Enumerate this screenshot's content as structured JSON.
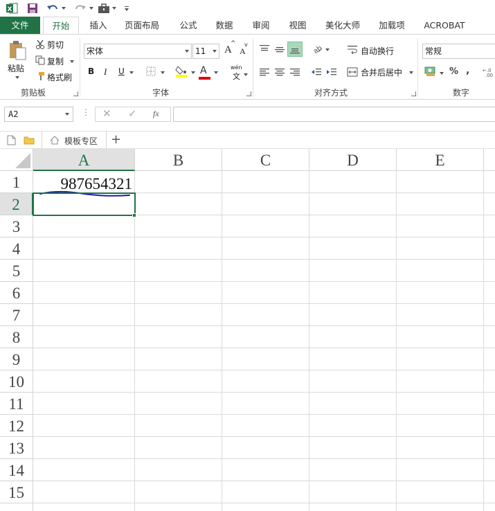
{
  "ribbon_tabs": {
    "file": "文件",
    "home": "开始",
    "insert": "插入",
    "page_layout": "页面布局",
    "formulas": "公式",
    "data": "数据",
    "review": "审阅",
    "view": "视图",
    "meihua": "美化大师",
    "addins": "加载项",
    "acrobat": "ACROBAT"
  },
  "clipboard": {
    "paste": "粘贴",
    "cut": "剪切",
    "copy": "复制",
    "format_painter": "格式刷",
    "group_label": "剪贴板"
  },
  "font": {
    "font_name": "宋体",
    "font_size": "11",
    "grow_label": "A",
    "shrink_label": "A",
    "bold": "B",
    "italic": "I",
    "underline": "U",
    "font_color_label": "A",
    "phonetic_top": "wén",
    "phonetic_bottom": "文",
    "group_label": "字体"
  },
  "alignment": {
    "wrap_text": "自动换行",
    "merge_center": "合并后居中",
    "group_label": "对齐方式"
  },
  "number": {
    "format": "常规",
    "percent": "%",
    "comma": ",",
    "group_label": "数字"
  },
  "formula_bar": {
    "name_box": "A2",
    "fx": "fx",
    "content": ""
  },
  "sheet_bar": {
    "template_zone": "模板专区",
    "add": "+"
  },
  "grid": {
    "columns": [
      "A",
      "B",
      "C",
      "D",
      "E"
    ],
    "rows": [
      "1",
      "2",
      "3",
      "4",
      "5",
      "6",
      "7",
      "8",
      "9",
      "10",
      "11",
      "12",
      "13",
      "14",
      "15"
    ],
    "cell_A1": "987654321",
    "selected_cell": "A2"
  },
  "colors": {
    "accent": "#217346",
    "highlight": "#ffff00",
    "font_color": "#e00000",
    "annotation": "#1a1aaa"
  }
}
